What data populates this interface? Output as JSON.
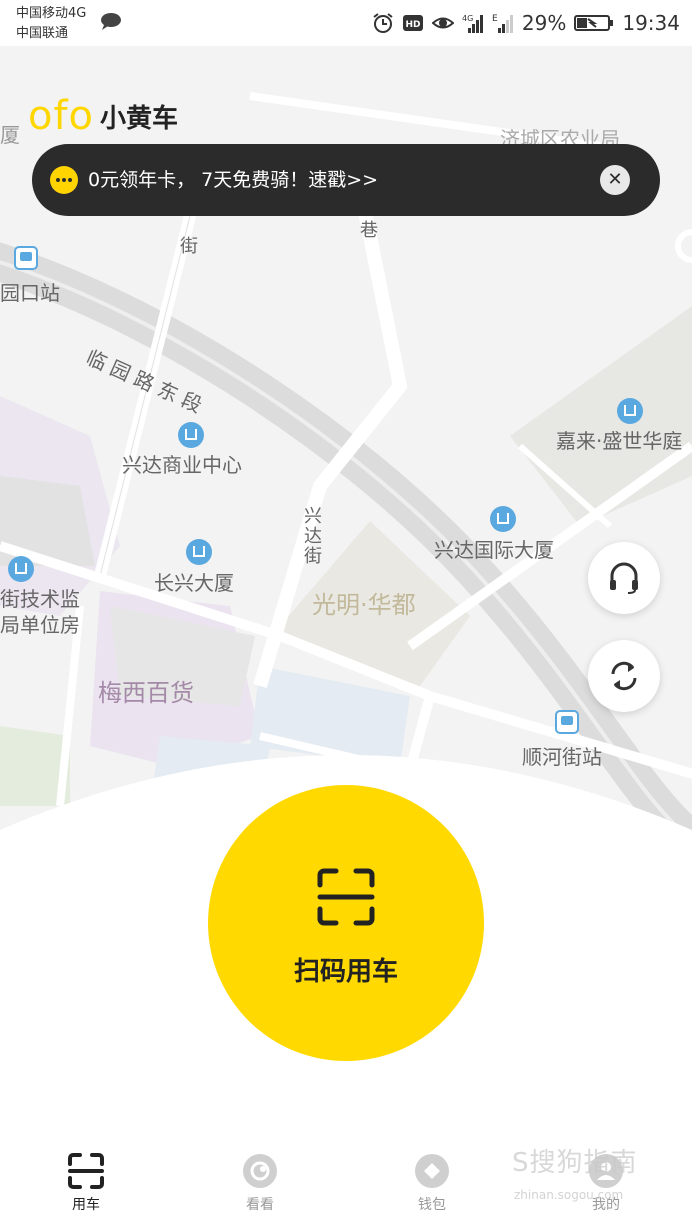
{
  "status_bar": {
    "carrier_1": "中国移动4G",
    "carrier_2": "中国联通",
    "battery": "29%",
    "time": "19:34",
    "icons": [
      "message-icon",
      "alarm-icon",
      "hd-icon",
      "eye-icon",
      "signal-4g-icon",
      "signal-e-icon",
      "battery-icon"
    ]
  },
  "app": {
    "logo_mark": "ofo",
    "logo_text": "小黄车",
    "brand_color": "#ffd600"
  },
  "banner": {
    "text": "0元领年卡， 7天免费骑！速戳>>",
    "close_symbol": "✕"
  },
  "map": {
    "labels": {
      "bus_stop_1": "园口站",
      "road_1": "临园路东段",
      "road_2": "兴达街",
      "road_3": "巷",
      "road_4": "街",
      "poi_1": "兴达商业中心",
      "poi_2": "长兴大厦",
      "poi_3": "兴达国际大厦",
      "poi_4": "嘉来·盛世华庭",
      "poi_5_line1": "街技术监",
      "poi_5_line2": "局单位房",
      "area_1": "光明·华都",
      "area_2": "梅西百货",
      "bus_stop_2": "顺河街站",
      "top_left": "厦",
      "top_right": "济城区农业局"
    }
  },
  "actions": {
    "support_icon": "headset-icon",
    "refresh_icon": "refresh-icon",
    "scan_label": "扫码用车",
    "scan_color": "#ffd900"
  },
  "tabs": [
    {
      "label": "用车",
      "icon": "scan-icon",
      "active": true
    },
    {
      "label": "看看",
      "icon": "eye-circle-icon",
      "active": false
    },
    {
      "label": "钱包",
      "icon": "wallet-icon",
      "active": false
    },
    {
      "label": "我的",
      "icon": "user-icon",
      "active": false
    }
  ],
  "watermark": {
    "text": "S搜狗指南",
    "sub": "zhinan.sogou.com"
  }
}
